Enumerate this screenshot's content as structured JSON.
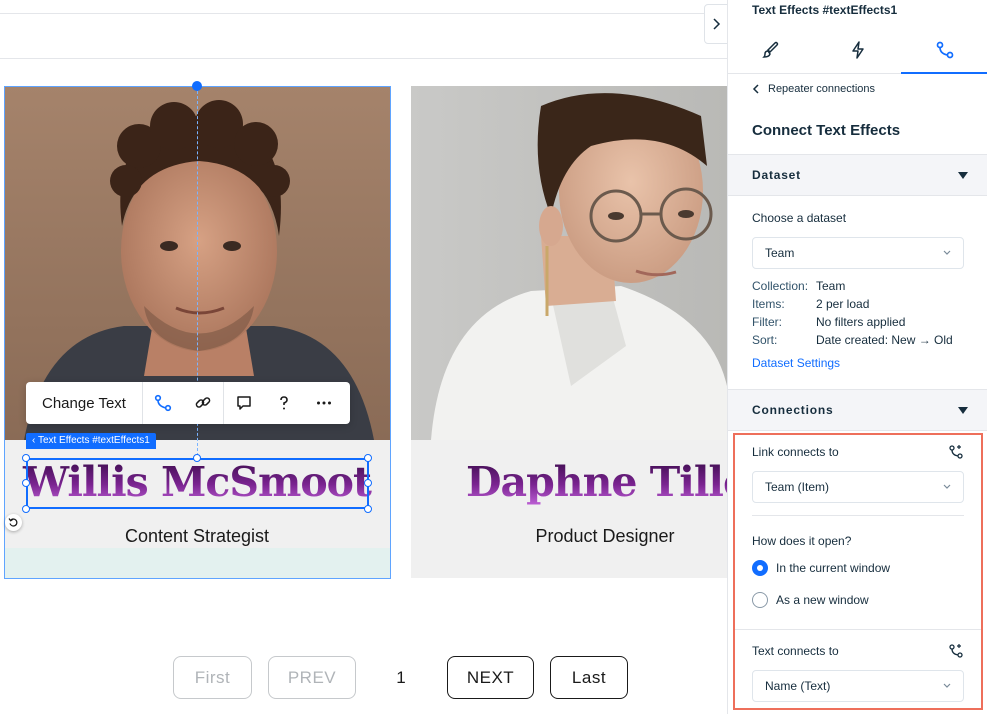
{
  "canvas": {
    "cards": [
      {
        "name": "Willis McSmoot",
        "role": "Content Strategist"
      },
      {
        "name": "Daphne Tiller",
        "role": "Product Designer"
      }
    ],
    "toolbar": {
      "change_text": "Change Text"
    },
    "element_tag": "Text Effects #textEffects1",
    "pagination": {
      "first": "First",
      "prev": "PREV",
      "page": "1",
      "next": "NEXT",
      "last": "Last"
    }
  },
  "panel": {
    "title": "Text Effects #textEffects1",
    "tabs": [
      "design",
      "interactions",
      "connect"
    ],
    "back_link": "Repeater connections",
    "heading": "Connect Text Effects",
    "dataset_section": {
      "label": "Dataset",
      "choose_label": "Choose a dataset",
      "selected": "Team",
      "info": [
        {
          "key": "Collection:",
          "value": "Team"
        },
        {
          "key": "Items:",
          "value": "2 per load"
        },
        {
          "key": "Filter:",
          "value": "No filters applied"
        },
        {
          "key": "Sort:",
          "value": "Date created: New → Old"
        }
      ],
      "settings_link": "Dataset Settings"
    },
    "connections_section": {
      "label": "Connections",
      "link_label": "Link connects to",
      "link_value": "Team (Item)",
      "open_label": "How does it open?",
      "options": [
        "In the current window",
        "As a new window"
      ],
      "selected_option": 0,
      "text_label": "Text connects to",
      "text_value": "Name (Text)"
    }
  },
  "colors": {
    "accent": "#116dff",
    "highlight": "#ee6f5b",
    "name_gradient_top": "#3a0b4a",
    "name_gradient_bottom": "#c062d8"
  }
}
